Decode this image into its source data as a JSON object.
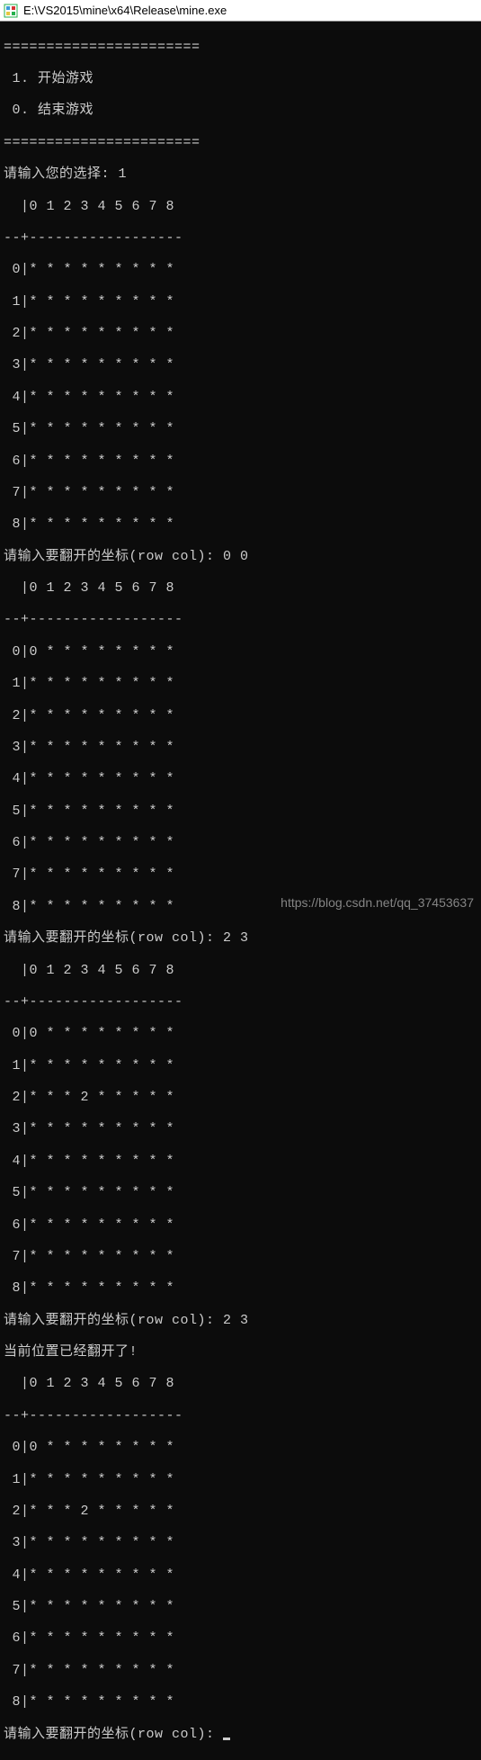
{
  "window": {
    "title": "E:\\VS2015\\mine\\x64\\Release\\mine.exe"
  },
  "divider": "=======================",
  "menu": {
    "item1": " 1. 开始游戏",
    "item0": " 0. 结束游戏"
  },
  "prompt_choice": {
    "label": "请输入您的选择: ",
    "value": "1"
  },
  "col_header": "  |0 1 2 3 4 5 6 7 8",
  "row_sep": "--+------------------",
  "boards": [
    {
      "rows": [
        " 0|* * * * * * * * *",
        " 1|* * * * * * * * *",
        " 2|* * * * * * * * *",
        " 3|* * * * * * * * *",
        " 4|* * * * * * * * *",
        " 5|* * * * * * * * *",
        " 6|* * * * * * * * *",
        " 7|* * * * * * * * *",
        " 8|* * * * * * * * *"
      ]
    },
    {
      "rows": [
        " 0|0 * * * * * * * *",
        " 1|* * * * * * * * *",
        " 2|* * * * * * * * *",
        " 3|* * * * * * * * *",
        " 4|* * * * * * * * *",
        " 5|* * * * * * * * *",
        " 6|* * * * * * * * *",
        " 7|* * * * * * * * *",
        " 8|* * * * * * * * *"
      ]
    },
    {
      "rows": [
        " 0|0 * * * * * * * *",
        " 1|* * * * * * * * *",
        " 2|* * * 2 * * * * *",
        " 3|* * * * * * * * *",
        " 4|* * * * * * * * *",
        " 5|* * * * * * * * *",
        " 6|* * * * * * * * *",
        " 7|* * * * * * * * *",
        " 8|* * * * * * * * *"
      ]
    },
    {
      "rows": [
        " 0|0 * * * * * * * *",
        " 1|* * * * * * * * *",
        " 2|* * * 2 * * * * *",
        " 3|* * * * * * * * *",
        " 4|* * * * * * * * *",
        " 5|* * * * * * * * *",
        " 6|* * * * * * * * *",
        " 7|* * * * * * * * *",
        " 8|* * * * * * * * *"
      ]
    }
  ],
  "prompts": {
    "coord_label": "请输入要翻开的坐标(row col): ",
    "input1": "0 0",
    "input2": "2 3",
    "input3": "2 3",
    "already_open": "当前位置已经翻开了!"
  },
  "watermark": "https://blog.csdn.net/qq_37453637"
}
